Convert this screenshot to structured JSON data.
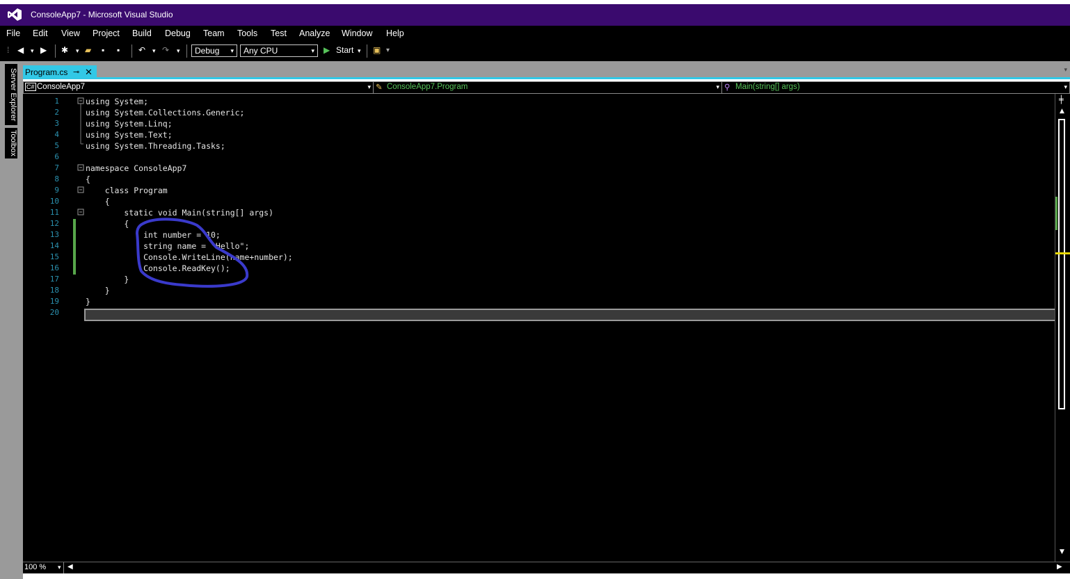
{
  "window": {
    "title": "ConsoleApp7 - Microsoft Visual Studio"
  },
  "menu": [
    "File",
    "Edit",
    "View",
    "Project",
    "Build",
    "Debug",
    "Team",
    "Tools",
    "Test",
    "Analyze",
    "Window",
    "Help"
  ],
  "toolbar": {
    "configuration": "Debug",
    "platform": "Any CPU",
    "start_label": "Start"
  },
  "side_tabs": [
    "Server Explorer",
    "Toolbox"
  ],
  "document_tab": {
    "name": "Program.cs"
  },
  "navigation": {
    "project": "ConsoleApp7",
    "type": "ConsoleApp7.Program",
    "member": "Main(string[] args)"
  },
  "editor": {
    "zoom": "100 %",
    "line_numbers": [
      "1",
      "2",
      "3",
      "4",
      "5",
      "6",
      "7",
      "8",
      "9",
      "10",
      "11",
      "12",
      "13",
      "14",
      "15",
      "16",
      "17",
      "18",
      "19",
      "20"
    ],
    "lines": [
      "using System;",
      "using System.Collections.Generic;",
      "using System.Linq;",
      "using System.Text;",
      "using System.Threading.Tasks;",
      "",
      "namespace ConsoleApp7",
      "{",
      "    class Program",
      "    {",
      "        static void Main(string[] args)",
      "        {",
      "            int number = 10;",
      "            string name = \"Hello\";",
      "            Console.WriteLine(name+number);",
      "            Console.ReadKey();",
      "        }",
      "    }",
      "}",
      ""
    ]
  },
  "colors": {
    "title_bar": "#3a0a6e",
    "accent": "#32c8e6",
    "editor_bg": "#000000",
    "line_number": "#2b91af",
    "changed_marker": "#57a64a",
    "annotation": "#3a3acb"
  }
}
